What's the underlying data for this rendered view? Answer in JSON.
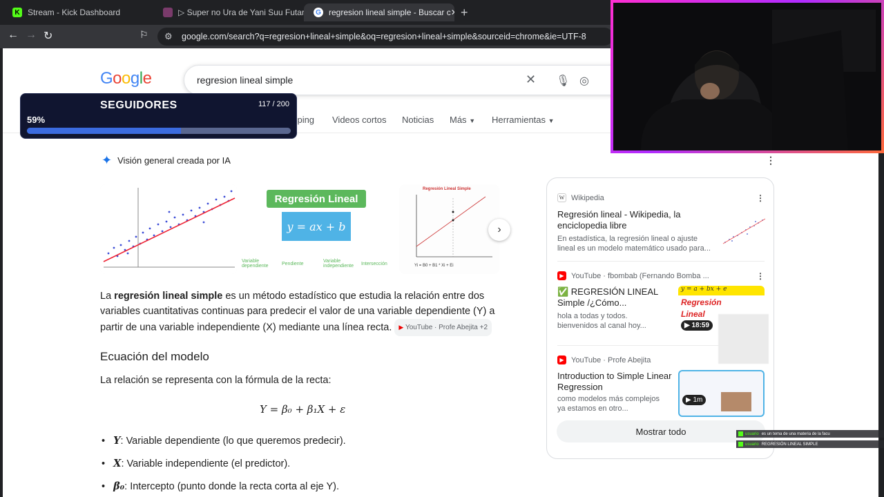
{
  "browser": {
    "tabs": [
      {
        "title": "Stream - Kick Dashboard",
        "active": false
      },
      {
        "title": "▷ Super no Ura de Yani Suu Futari Ca",
        "active": false
      },
      {
        "title": "regresion lineal simple - Buscar c",
        "active": true
      }
    ],
    "url": "google.com/search?q=regresion+lineal+simple&oq=regresion+lineal+simple&sourceid=chrome&ie=UTF-8"
  },
  "google": {
    "logo": "Google",
    "query": "regresion lineal simple",
    "tabs": [
      "opping",
      "Videos cortos",
      "Noticias",
      "Más",
      "Herramientas"
    ]
  },
  "ai_overview": {
    "label": "Visión general creada por IA",
    "images": [
      {
        "caption": ""
      },
      {
        "caption": "Regresión Lineal",
        "formula": "y = ax + b",
        "labels": [
          "Variable dependiente",
          "Pendiente",
          "Variable independiente",
          "Intersección"
        ]
      },
      {
        "caption": "Regresión Lineal Simple",
        "formula": "Yi = B0 + B1 * Xi + Ei"
      }
    ],
    "intro_pre": "La ",
    "intro_bold": "regresión lineal simple",
    "intro_post": " es un método estadístico que estudia la relación entre dos variables cuantitativas continuas para predecir el valor de una variable dependiente (Y) a partir de una variable independiente (X) mediante una línea recta.",
    "intro_source": "YouTube · Profe Abejita +2",
    "heading": "Ecuación del modelo",
    "relation_text": "La relación se representa con la fórmula de la recta:",
    "formula": "Y = β₀ + β₁X + ε",
    "bullets": [
      {
        "symbol": "Y",
        "text": ": Variable dependiente (lo que queremos predecir)."
      },
      {
        "symbol": "X",
        "text": ": Variable independiente (el predictor)."
      },
      {
        "symbol": "β₀",
        "text": ": Intercepto (punto donde la recta corta al eje Y)."
      }
    ]
  },
  "sources": [
    {
      "site": "Wikipedia",
      "title": "Regresión lineal - Wikipedia, la enciclopedia libre",
      "desc": "En estadística, la regresión lineal o ajuste lineal es un modelo matemático usado para..."
    },
    {
      "site": "YouTube",
      "channel": "fbombab (Fernando Bomba ...",
      "title": "✅ REGRESIÓN LINEAL Simple /¿Cómo...",
      "desc": "hola a todas y todos. bienvenidos al canal hoy...",
      "duration": "18:59",
      "thumb_text": "Regresión Lineal",
      "thumb_formula": "y = a + bx + e"
    },
    {
      "site": "YouTube",
      "channel": "Profe Abejita",
      "title": "Introduction to Simple Linear Regression",
      "desc": "como modelos más complejos ya estamos en otro...",
      "duration": "1m"
    }
  ],
  "show_all": "Mostrar todo",
  "followers_widget": {
    "title": "SEGUIDORES",
    "count": "117 / 200",
    "percent": "59%",
    "progress": 0.585
  },
  "chat": [
    {
      "user": "usuario",
      "message": "es un tema de una materia de la facu"
    },
    {
      "user": "usuario",
      "message": "REGRESIÓN LINEAL SIMPLE"
    }
  ],
  "colors": {
    "google_blue": "#4285f4",
    "google_red": "#ea4335",
    "google_yellow": "#fbbc05",
    "google_green": "#34a853",
    "kick_green": "#53fc18",
    "progress_fill": "#3b6be0"
  }
}
